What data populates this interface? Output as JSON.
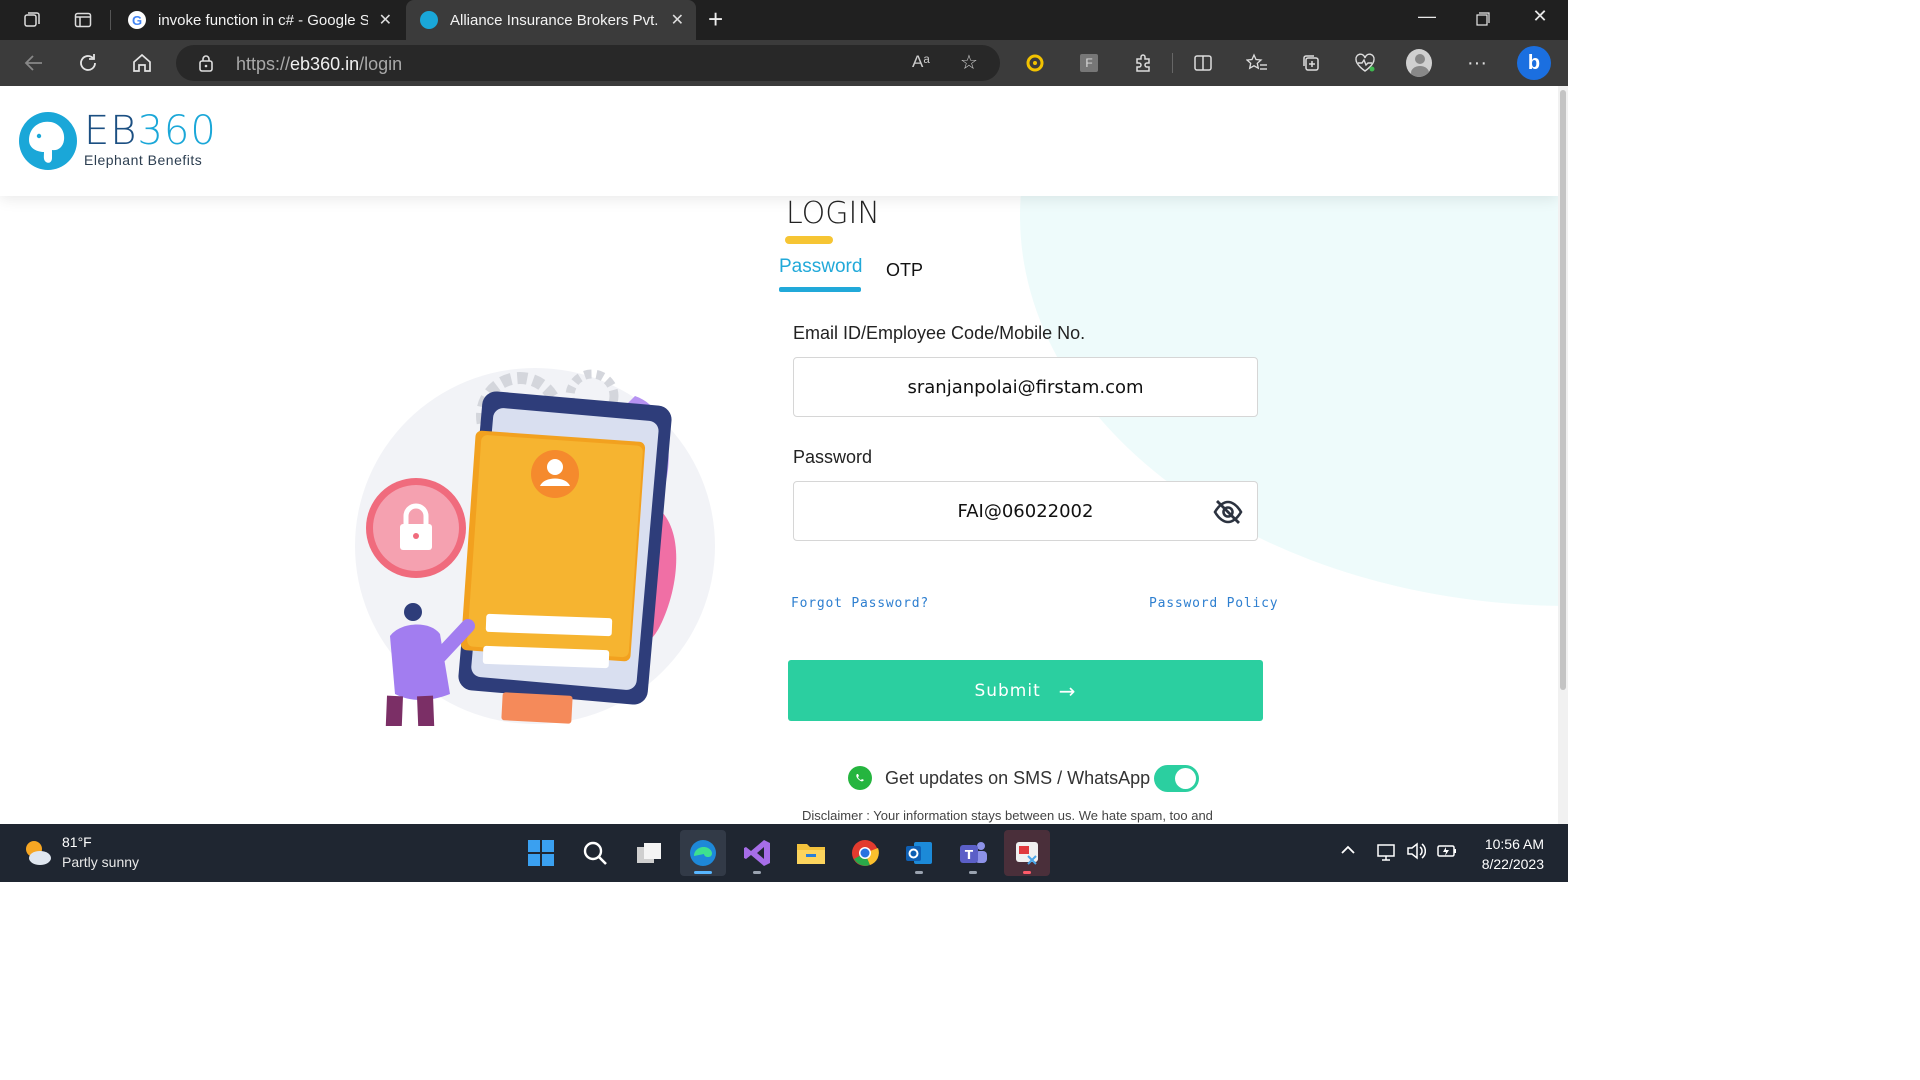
{
  "browser": {
    "tabs": [
      {
        "title": "invoke function in c# - Google Se",
        "active": false
      },
      {
        "title": "Alliance Insurance Brokers Pvt. Lt",
        "active": true
      }
    ],
    "url_prefix": "https://",
    "url_domain": "eb360.in",
    "url_path": "/login",
    "read_aloud_label": "Aᵃ",
    "menu_label": "···"
  },
  "site": {
    "logo_main": "EB",
    "logo_num": "360",
    "logo_sub": "Elephant Benefits"
  },
  "login": {
    "title": "LOGIN",
    "tab_password": "Password",
    "tab_otp": "OTP",
    "email_label": "Email ID/Employee Code/Mobile No.",
    "email_value": "sranjanpolai@firstam.com",
    "password_label": "Password",
    "password_value": "FAI@06022002",
    "forgot": "Forgot Password?",
    "policy": "Password Policy",
    "submit": "Submit",
    "updates": "Get updates on SMS / WhatsApp",
    "updates_enabled": true,
    "disclaimer": "Disclaimer : Your information stays between us. We hate spam, too and"
  },
  "taskbar": {
    "temperature": "81°F",
    "condition": "Partly sunny",
    "time": "10:56 AM",
    "date": "8/22/2023"
  },
  "colors": {
    "accent": "#21a9d9",
    "submit": "#2bcfa0",
    "underline": "#f6c533",
    "link": "#2e7fd0"
  }
}
